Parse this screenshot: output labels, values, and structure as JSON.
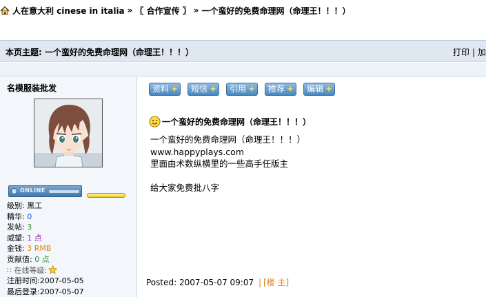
{
  "breadcrumb": {
    "items": [
      "人在意大利 cinese in italia",
      "〖 合作宣传 〗",
      "一个蛮好的免费命理网（命理王！！！）"
    ],
    "separator": "»"
  },
  "topic": {
    "label": "本页主题:",
    "title": "一个蛮好的免费命理网（命理王！！！）",
    "actions": [
      "打印",
      "加"
    ],
    "action_sep": "|"
  },
  "author": {
    "name": "名模服装批发",
    "status_label": "ONLINE",
    "stats": {
      "level_label": "级别:",
      "level_value": "黑工",
      "elite_label": "精华:",
      "elite_value": "0",
      "posts_label": "发帖:",
      "posts_value": "3",
      "prestige_label": "威望:",
      "prestige_value": "1 点",
      "money_label": "金钱:",
      "money_value": "3 RMB",
      "contrib_label": "贡献值:",
      "contrib_value": "0 点",
      "online_label": "在线等级:",
      "reg_label": "注册时间:",
      "reg_value": "2007-05-05",
      "last_label": "最后登录:",
      "last_value": "2007-05-07"
    }
  },
  "post": {
    "buttons": [
      "资料",
      "短信",
      "引用",
      "推荐",
      "编辑"
    ],
    "subject": "一个蛮好的免费命理网（命理王！！！）",
    "body_lines": [
      "一个蛮好的免费命理网（命理王！！！）",
      "www.happyplays.com",
      "里面由术数纵横里的一些高手任版主",
      "",
      "给大家免费批八字"
    ],
    "footer": {
      "posted_label": "Posted:",
      "posted_time": "2007-05-07 09:07",
      "sep": "|",
      "floor_label": "[楼 主]"
    }
  },
  "colors": {
    "topic_bar": "#dfe8f1",
    "author_bg": "#f3f7fb",
    "button_blue": "#4b87c0",
    "link_orange": "#e0821a"
  }
}
